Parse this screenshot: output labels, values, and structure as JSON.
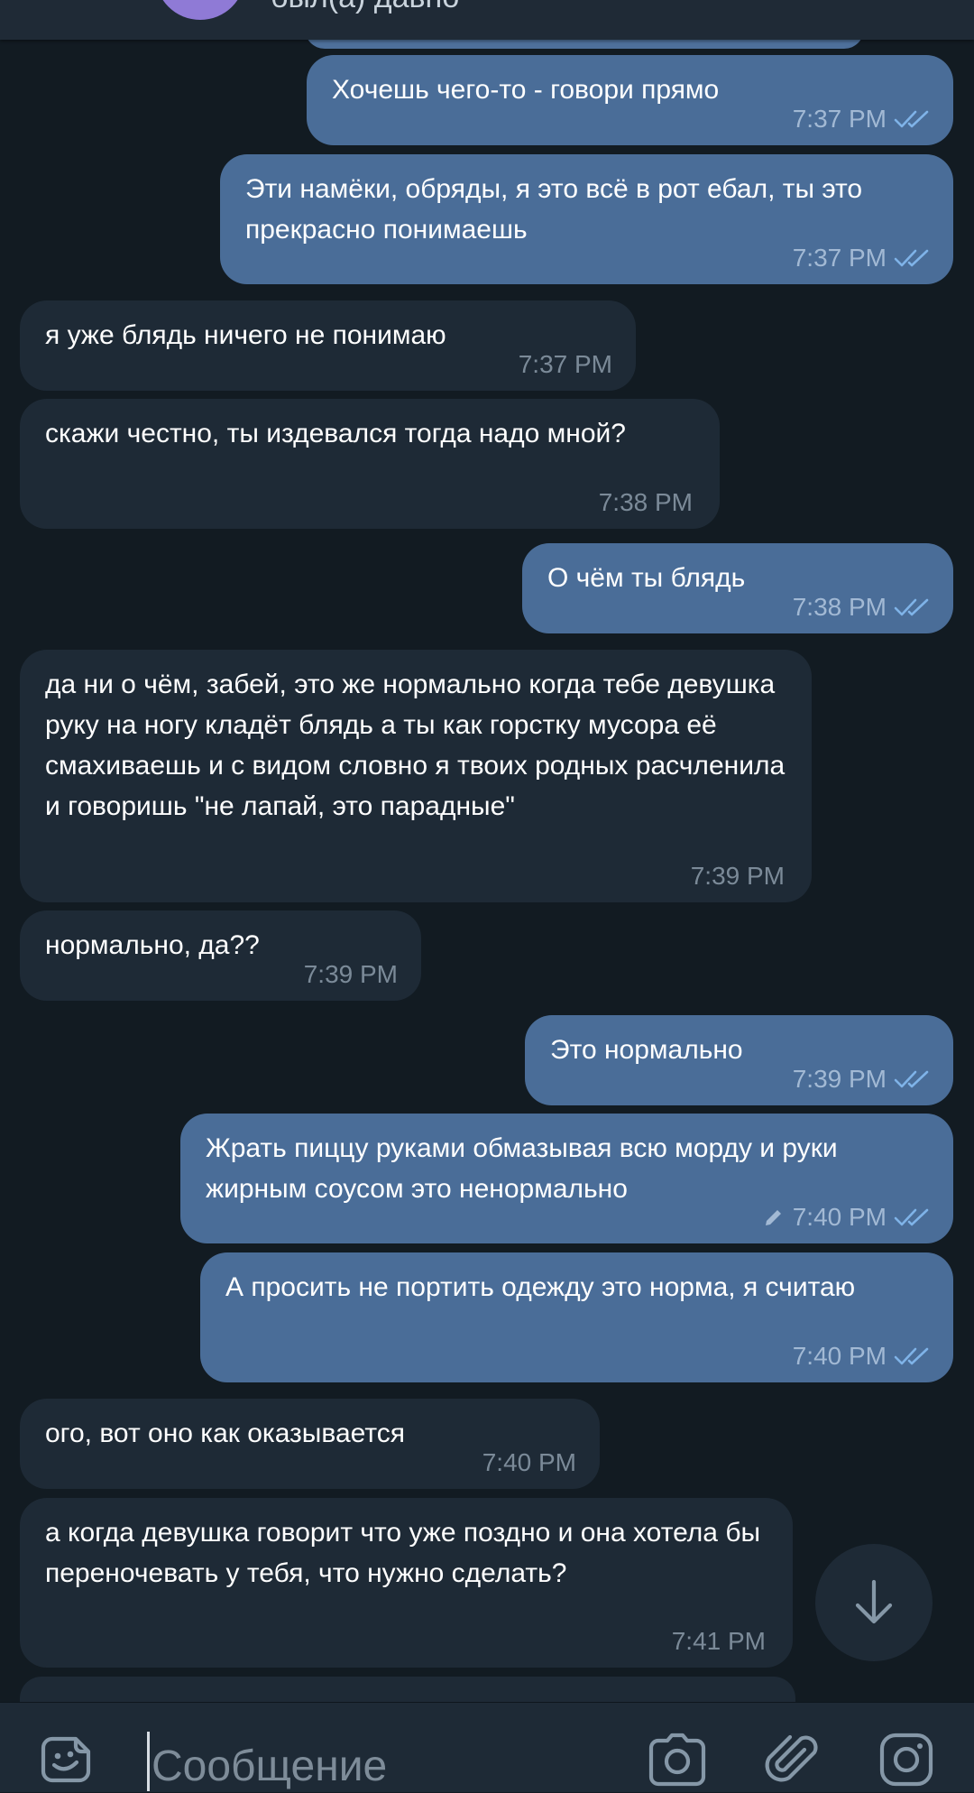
{
  "header": {
    "status": "был(а) давно",
    "avatar_color": "#8f7ad6"
  },
  "colors": {
    "background": "#121b22",
    "outgoing_bubble": "#4a6d98",
    "incoming_bubble": "#1e2a36",
    "read_check": "#7fb3e8"
  },
  "messages": [
    {
      "direction": "outgoing",
      "text": "Хочешь чего-то - говори прямо",
      "time": "7:37 PM",
      "status": "read-double-check-icon"
    },
    {
      "direction": "outgoing",
      "text": "Эти намёки, обряды, я это всё в рот ебал, ты это прекрасно понимаешь",
      "time": "7:37 PM",
      "status": "read-double-check-icon"
    },
    {
      "direction": "incoming",
      "text": "я уже блядь ничего не понимаю",
      "time": "7:37 PM"
    },
    {
      "direction": "incoming",
      "text": "скажи честно, ты издевался тогда надо мной?",
      "time": "7:38 PM"
    },
    {
      "direction": "outgoing",
      "text": "О чём ты блядь",
      "time": "7:38 PM",
      "status": "read-double-check-icon"
    },
    {
      "direction": "incoming",
      "text": "да ни о чём, забей, это же нормально когда тебе девушка руку на ногу кладёт блядь а ты как горстку мусора её смахиваешь и с видом словно я твоих родных расчленила и говоришь \"не лапай, это парадные\"",
      "time": "7:39 PM"
    },
    {
      "direction": "incoming",
      "text": "нормально, да??",
      "time": "7:39 PM"
    },
    {
      "direction": "outgoing",
      "text": "Это нормально",
      "time": "7:39 PM",
      "status": "read-double-check-icon"
    },
    {
      "direction": "outgoing",
      "text": "Жрать пиццу руками обмазывая всю морду и руки жирным соусом это ненормально",
      "time": "7:40 PM",
      "edited": true,
      "status": "read-double-check-icon"
    },
    {
      "direction": "outgoing",
      "text": "А просить не портить одежду это норма, я считаю",
      "time": "7:40 PM",
      "status": "read-double-check-icon"
    },
    {
      "direction": "incoming",
      "text": "ого, вот оно как оказывается",
      "time": "7:40 PM"
    },
    {
      "direction": "incoming",
      "text": "а когда девушка говорит что уже поздно и она хотела бы переночевать у тебя, что нужно сделать?",
      "time": "7:41 PM"
    }
  ],
  "scroll_down_button": {
    "icon": "arrow-down-icon"
  },
  "composer": {
    "placeholder": "Сообщение",
    "value": "",
    "icons": [
      "sticker-emoji-icon",
      "camera-icon",
      "paperclip-icon",
      "instagram-icon"
    ]
  }
}
